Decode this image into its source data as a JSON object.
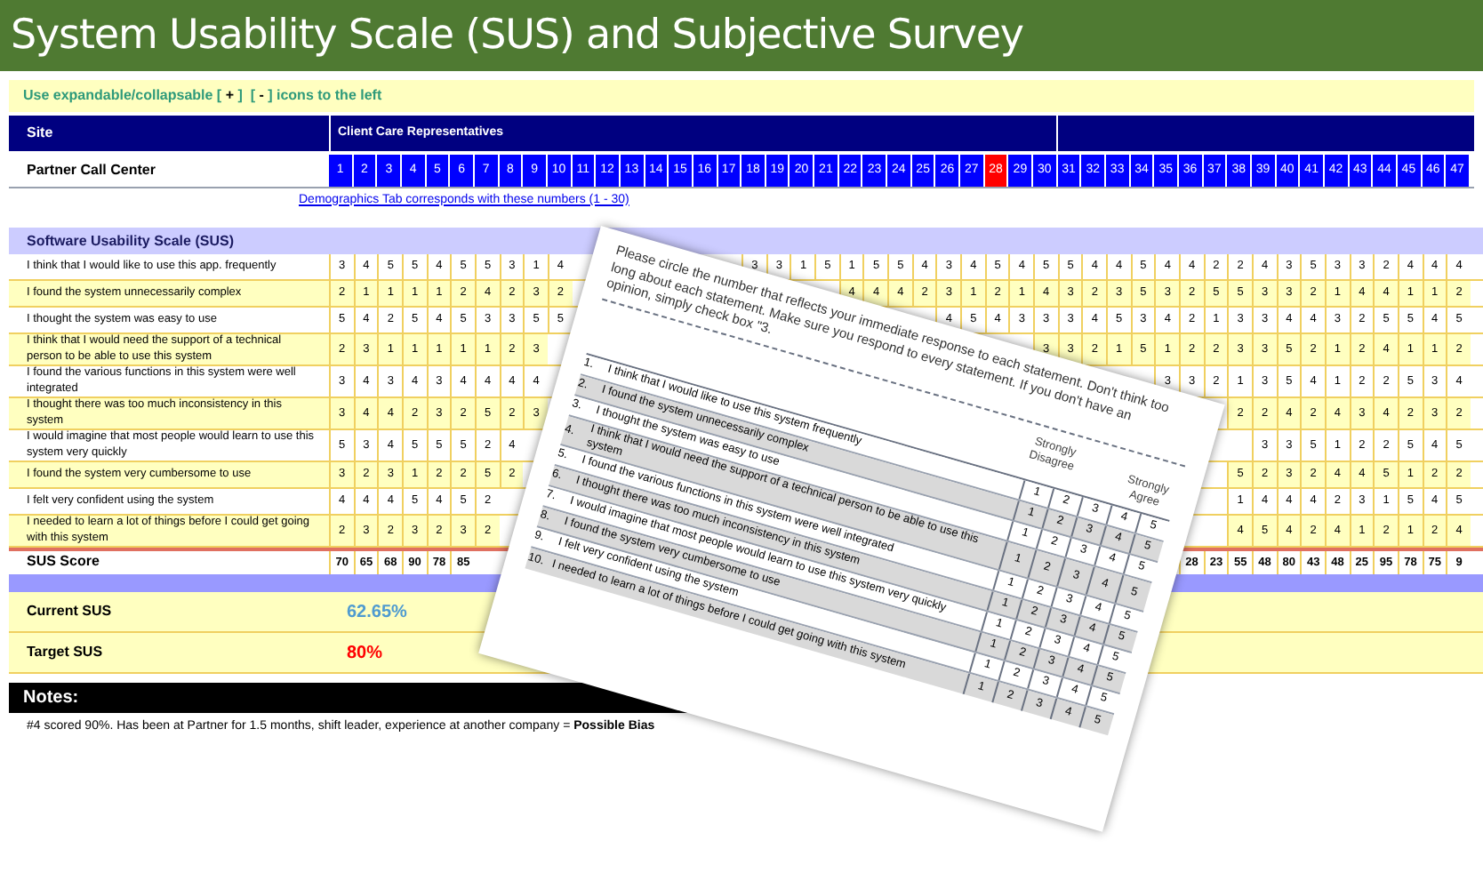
{
  "title": "System Usability Scale (SUS) and Subjective Survey",
  "instruction": "Use expandable/collapsable [ **+** ]  [ **-** ] icons to the left",
  "site_header": {
    "label": "Site",
    "group": "Client Care Representatives"
  },
  "site_row": {
    "label": "Partner Call Center",
    "numbers": [
      {
        "label": "1",
        "selected": false
      },
      {
        "label": "2",
        "selected": false
      },
      {
        "label": "3",
        "selected": false
      },
      {
        "label": "4",
        "selected": false
      },
      {
        "label": "5",
        "selected": false
      },
      {
        "label": "6",
        "selected": false
      },
      {
        "label": "7",
        "selected": false
      },
      {
        "label": "8",
        "selected": false
      },
      {
        "label": "9",
        "selected": false
      },
      {
        "label": "10",
        "selected": false
      },
      {
        "label": "11",
        "selected": false
      },
      {
        "label": "12",
        "selected": false
      },
      {
        "label": "13",
        "selected": false
      },
      {
        "label": "14",
        "selected": false
      },
      {
        "label": "15",
        "selected": false
      },
      {
        "label": "16",
        "selected": false
      },
      {
        "label": "17",
        "selected": false
      },
      {
        "label": "18",
        "selected": false
      },
      {
        "label": "19",
        "selected": false
      },
      {
        "label": "20",
        "selected": false
      },
      {
        "label": "21",
        "selected": false
      },
      {
        "label": "22",
        "selected": false
      },
      {
        "label": "23",
        "selected": false
      },
      {
        "label": "24",
        "selected": false
      },
      {
        "label": "25",
        "selected": false
      },
      {
        "label": "26",
        "selected": false
      },
      {
        "label": "27",
        "selected": false
      },
      {
        "label": "28",
        "selected": true
      },
      {
        "label": "29",
        "selected": false
      },
      {
        "label": "30",
        "selected": false
      },
      {
        "label": "31",
        "selected": false
      },
      {
        "label": "32",
        "selected": false
      },
      {
        "label": "33",
        "selected": false
      },
      {
        "label": "34",
        "selected": false
      },
      {
        "label": "35",
        "selected": false
      },
      {
        "label": "36",
        "selected": false
      },
      {
        "label": "37",
        "selected": false
      },
      {
        "label": "38",
        "selected": false
      },
      {
        "label": "39",
        "selected": false
      },
      {
        "label": "40",
        "selected": false
      },
      {
        "label": "41",
        "selected": false
      },
      {
        "label": "42",
        "selected": false
      },
      {
        "label": "43",
        "selected": false
      },
      {
        "label": "44",
        "selected": false
      },
      {
        "label": "45",
        "selected": false
      },
      {
        "label": "46",
        "selected": false
      },
      {
        "label": "47",
        "selected": false
      }
    ]
  },
  "link": "Demographics Tab corresponds with these numbers (1 - 30)",
  "sus": {
    "heading": "Software Usability Scale (SUS)",
    "rows": [
      {
        "label": "I think that I would like to use this app. frequently",
        "left_values": [
          "3",
          "4",
          "5",
          "5",
          "4",
          "5",
          "5",
          "3",
          "1",
          "4"
        ],
        "right_values": [
          "3",
          "3",
          "1",
          "5",
          "1",
          "5",
          "5",
          "4",
          "3",
          "4",
          "5",
          "4",
          "5",
          "5",
          "4",
          "4",
          "5",
          "4",
          "4",
          "2",
          "2",
          "4",
          "3",
          "5",
          "3",
          "3",
          "2",
          "4",
          "4",
          "4"
        ]
      },
      {
        "label": "I found the system unnecessarily complex",
        "left_values": [
          "2",
          "1",
          "1",
          "1",
          "1",
          "2",
          "4",
          "2",
          "3",
          "2"
        ],
        "right_values": [
          "4",
          "4",
          "4",
          "2",
          "3",
          "1",
          "2",
          "1",
          "4",
          "3",
          "2",
          "3",
          "5",
          "3",
          "2",
          "5",
          "5",
          "3",
          "3",
          "2",
          "1",
          "4",
          "4",
          "1",
          "1",
          "2"
        ]
      },
      {
        "label": "I thought the system was easy to use",
        "left_values": [
          "5",
          "4",
          "2",
          "5",
          "4",
          "5",
          "3",
          "3",
          "5",
          "5"
        ],
        "right_values": [
          "4",
          "5",
          "4",
          "3",
          "3",
          "3",
          "4",
          "5",
          "3",
          "4",
          "2",
          "1",
          "3",
          "3",
          "4",
          "4",
          "3",
          "2",
          "5",
          "5",
          "4",
          "5"
        ]
      },
      {
        "label": "I think that I would need the support of a technical person to be able to use this system",
        "left_values": [
          "2",
          "3",
          "1",
          "1",
          "1",
          "1",
          "1",
          "2",
          "3"
        ],
        "right_values": [
          "3",
          "3",
          "2",
          "1",
          "5",
          "1",
          "2",
          "2",
          "3",
          "3",
          "5",
          "2",
          "1",
          "2",
          "4",
          "1",
          "1",
          "2"
        ]
      },
      {
        "label": "I found the various functions in this system were well integrated",
        "left_values": [
          "3",
          "4",
          "3",
          "4",
          "3",
          "4",
          "4",
          "4",
          "4"
        ],
        "right_values": [
          "3",
          "3",
          "2",
          "1",
          "3",
          "5",
          "4",
          "1",
          "2",
          "2",
          "5",
          "3",
          "4"
        ]
      },
      {
        "label": "I thought there was too much inconsistency in this system",
        "left_values": [
          "3",
          "4",
          "4",
          "2",
          "3",
          "2",
          "5",
          "2",
          "3"
        ],
        "right_values": [
          "2",
          "2",
          "4",
          "2",
          "4",
          "3",
          "4",
          "2",
          "3",
          "2"
        ]
      },
      {
        "label": "I would imagine that most people would learn to use this system very quickly",
        "left_values": [
          "5",
          "3",
          "4",
          "5",
          "5",
          "5",
          "2",
          "4"
        ],
        "right_values": [
          "3",
          "3",
          "5",
          "1",
          "2",
          "2",
          "5",
          "4",
          "5"
        ]
      },
      {
        "label": "I found the system very cumbersome to use",
        "left_values": [
          "3",
          "2",
          "3",
          "1",
          "2",
          "2",
          "5",
          "2"
        ],
        "right_values": [
          "5",
          "2",
          "3",
          "2",
          "4",
          "4",
          "5",
          "1",
          "2",
          "2"
        ]
      },
      {
        "label": "I felt very confident using the system",
        "left_values": [
          "4",
          "4",
          "4",
          "5",
          "4",
          "5",
          "2"
        ],
        "right_values": [
          "1",
          "4",
          "4",
          "4",
          "2",
          "3",
          "1",
          "5",
          "4",
          "5"
        ]
      },
      {
        "label": "I needed to learn a lot of things before I could get going with this system",
        "left_values": [
          "2",
          "3",
          "2",
          "3",
          "2",
          "3",
          "2"
        ],
        "right_values": [
          "4",
          "5",
          "4",
          "2",
          "4",
          "1",
          "2",
          "1",
          "2",
          "4"
        ]
      }
    ],
    "score": {
      "label": "SUS Score",
      "left_values": [
        "70",
        "65",
        "68",
        "90",
        "78",
        "85"
      ],
      "right_values": [
        "28",
        "23",
        "55",
        "48",
        "80",
        "43",
        "48",
        "25",
        "95",
        "78",
        "75",
        "9"
      ]
    }
  },
  "summary": [
    {
      "label": "Current SUS",
      "value": "62.65%",
      "kind": "current"
    },
    {
      "label": "Target SUS",
      "value": "80%",
      "kind": "target"
    }
  ],
  "notes": {
    "heading": "Notes:",
    "text": "#4 scored 90%. Has been at Partner for 1.5 months, shift leader, experience at another company = **Possible Bias**"
  },
  "survey_sheet": {
    "instructions": "Please circle the number that reflects your immediate response to each statement. Don't think too long about each statement. Make sure you respond to every statement. If you don't have an opinion, simply check box \"3.",
    "low_label": "Strongly Disagree",
    "high_label": "Strongly Agree",
    "items": [
      {
        "number": "1.",
        "text": "I think that I would like to use this system frequently",
        "scale": [
          "1",
          "2",
          "3",
          "4",
          "5"
        ]
      },
      {
        "number": "2.",
        "text": "I found the system unnecessarily complex",
        "scale": [
          "1",
          "2",
          "3",
          "4",
          "5"
        ]
      },
      {
        "number": "3.",
        "text": "I thought the system was easy to use",
        "scale": [
          "1",
          "2",
          "3",
          "4",
          "5"
        ]
      },
      {
        "number": "4.",
        "text": "I think that I would need the support of a technical person to be able to use this system",
        "scale": [
          "1",
          "2",
          "3",
          "4",
          "5"
        ]
      },
      {
        "number": "5.",
        "text": "I found the various functions in this system were well integrated",
        "scale": [
          "1",
          "2",
          "3",
          "4",
          "5"
        ]
      },
      {
        "number": "6.",
        "text": "I thought there was too much inconsistency in this system",
        "scale": [
          "1",
          "2",
          "3",
          "4",
          "5"
        ]
      },
      {
        "number": "7.",
        "text": "I would imagine that most people would learn to use this system very quickly",
        "scale": [
          "1",
          "2",
          "3",
          "4",
          "5"
        ]
      },
      {
        "number": "8.",
        "text": "I found the system very cumbersome to use",
        "scale": [
          "1",
          "2",
          "3",
          "4",
          "5"
        ]
      },
      {
        "number": "9.",
        "text": "I felt very confident using the system",
        "scale": [
          "1",
          "2",
          "3",
          "4",
          "5"
        ]
      },
      {
        "number": "10.",
        "text": "I needed to learn a lot of things before I could get going with this system",
        "scale": [
          "1",
          "2",
          "3",
          "4",
          "5"
        ]
      }
    ]
  }
}
